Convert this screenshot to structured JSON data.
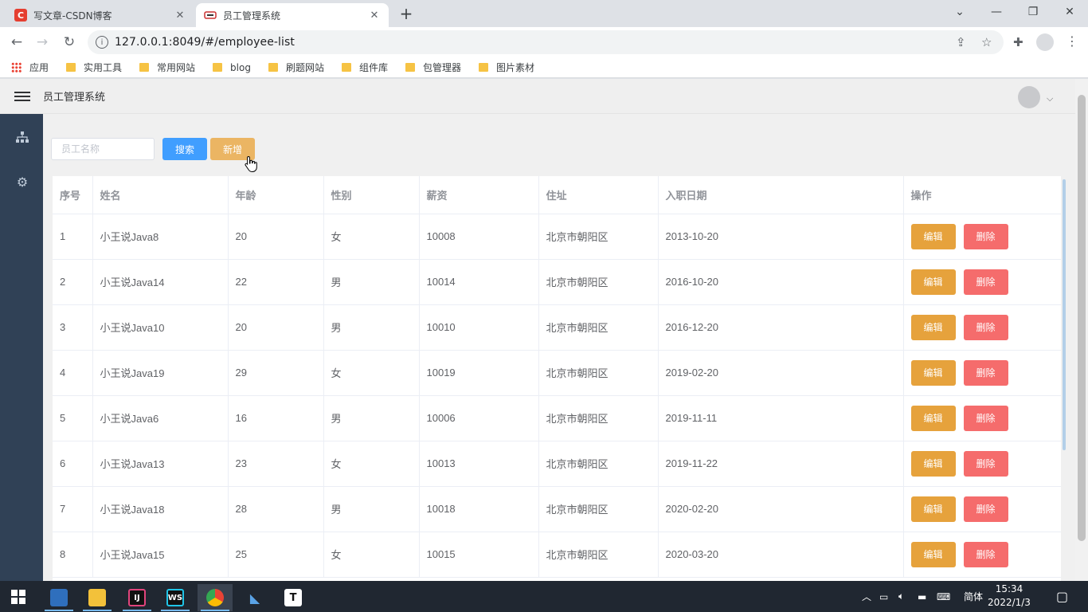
{
  "browser": {
    "tabs": [
      {
        "title": "写文章-CSDN博客",
        "favicon": "C"
      },
      {
        "title": "员工管理系统",
        "favicon": "EMS"
      }
    ],
    "new_tab": "+",
    "url": "127.0.0.1:8049/#/employee-list",
    "bookmarks": [
      "应用",
      "实用工具",
      "常用网站",
      "blog",
      "刷题网站",
      "组件库",
      "包管理器",
      "图片素材"
    ]
  },
  "app": {
    "title": "员工管理系统",
    "search_placeholder": "员工名称",
    "search_label": "搜索",
    "add_label": "新增",
    "edit_label": "编辑",
    "delete_label": "删除",
    "columns": [
      "序号",
      "姓名",
      "年龄",
      "性别",
      "薪资",
      "住址",
      "入职日期",
      "操作"
    ],
    "rows": [
      {
        "id": "1",
        "name": "小王说Java8",
        "age": "20",
        "gender": "女",
        "salary": "10008",
        "address": "北京市朝阳区",
        "date": "2013-10-20"
      },
      {
        "id": "2",
        "name": "小王说Java14",
        "age": "22",
        "gender": "男",
        "salary": "10014",
        "address": "北京市朝阳区",
        "date": "2016-10-20"
      },
      {
        "id": "3",
        "name": "小王说Java10",
        "age": "20",
        "gender": "男",
        "salary": "10010",
        "address": "北京市朝阳区",
        "date": "2016-12-20"
      },
      {
        "id": "4",
        "name": "小王说Java19",
        "age": "29",
        "gender": "女",
        "salary": "10019",
        "address": "北京市朝阳区",
        "date": "2019-02-20"
      },
      {
        "id": "5",
        "name": "小王说Java6",
        "age": "16",
        "gender": "男",
        "salary": "10006",
        "address": "北京市朝阳区",
        "date": "2019-11-11"
      },
      {
        "id": "6",
        "name": "小王说Java13",
        "age": "23",
        "gender": "女",
        "salary": "10013",
        "address": "北京市朝阳区",
        "date": "2019-11-22"
      },
      {
        "id": "7",
        "name": "小王说Java18",
        "age": "28",
        "gender": "男",
        "salary": "10018",
        "address": "北京市朝阳区",
        "date": "2020-02-20"
      },
      {
        "id": "8",
        "name": "小王说Java15",
        "age": "25",
        "gender": "女",
        "salary": "10015",
        "address": "北京市朝阳区",
        "date": "2020-03-20"
      }
    ]
  },
  "taskbar": {
    "ime": "简体",
    "time": "15:34",
    "date": "2022/1/3",
    "apps": [
      "desktop-icon",
      "file-explorer-icon",
      "intellij-icon",
      "webstorm-icon",
      "chrome-icon",
      "dolphin-icon",
      "typora-icon"
    ]
  },
  "colors": {
    "primary": "#409eff",
    "add": "#ebb563",
    "edit": "#e6a23c",
    "delete": "#f56c6c",
    "sidebar": "#304156"
  }
}
